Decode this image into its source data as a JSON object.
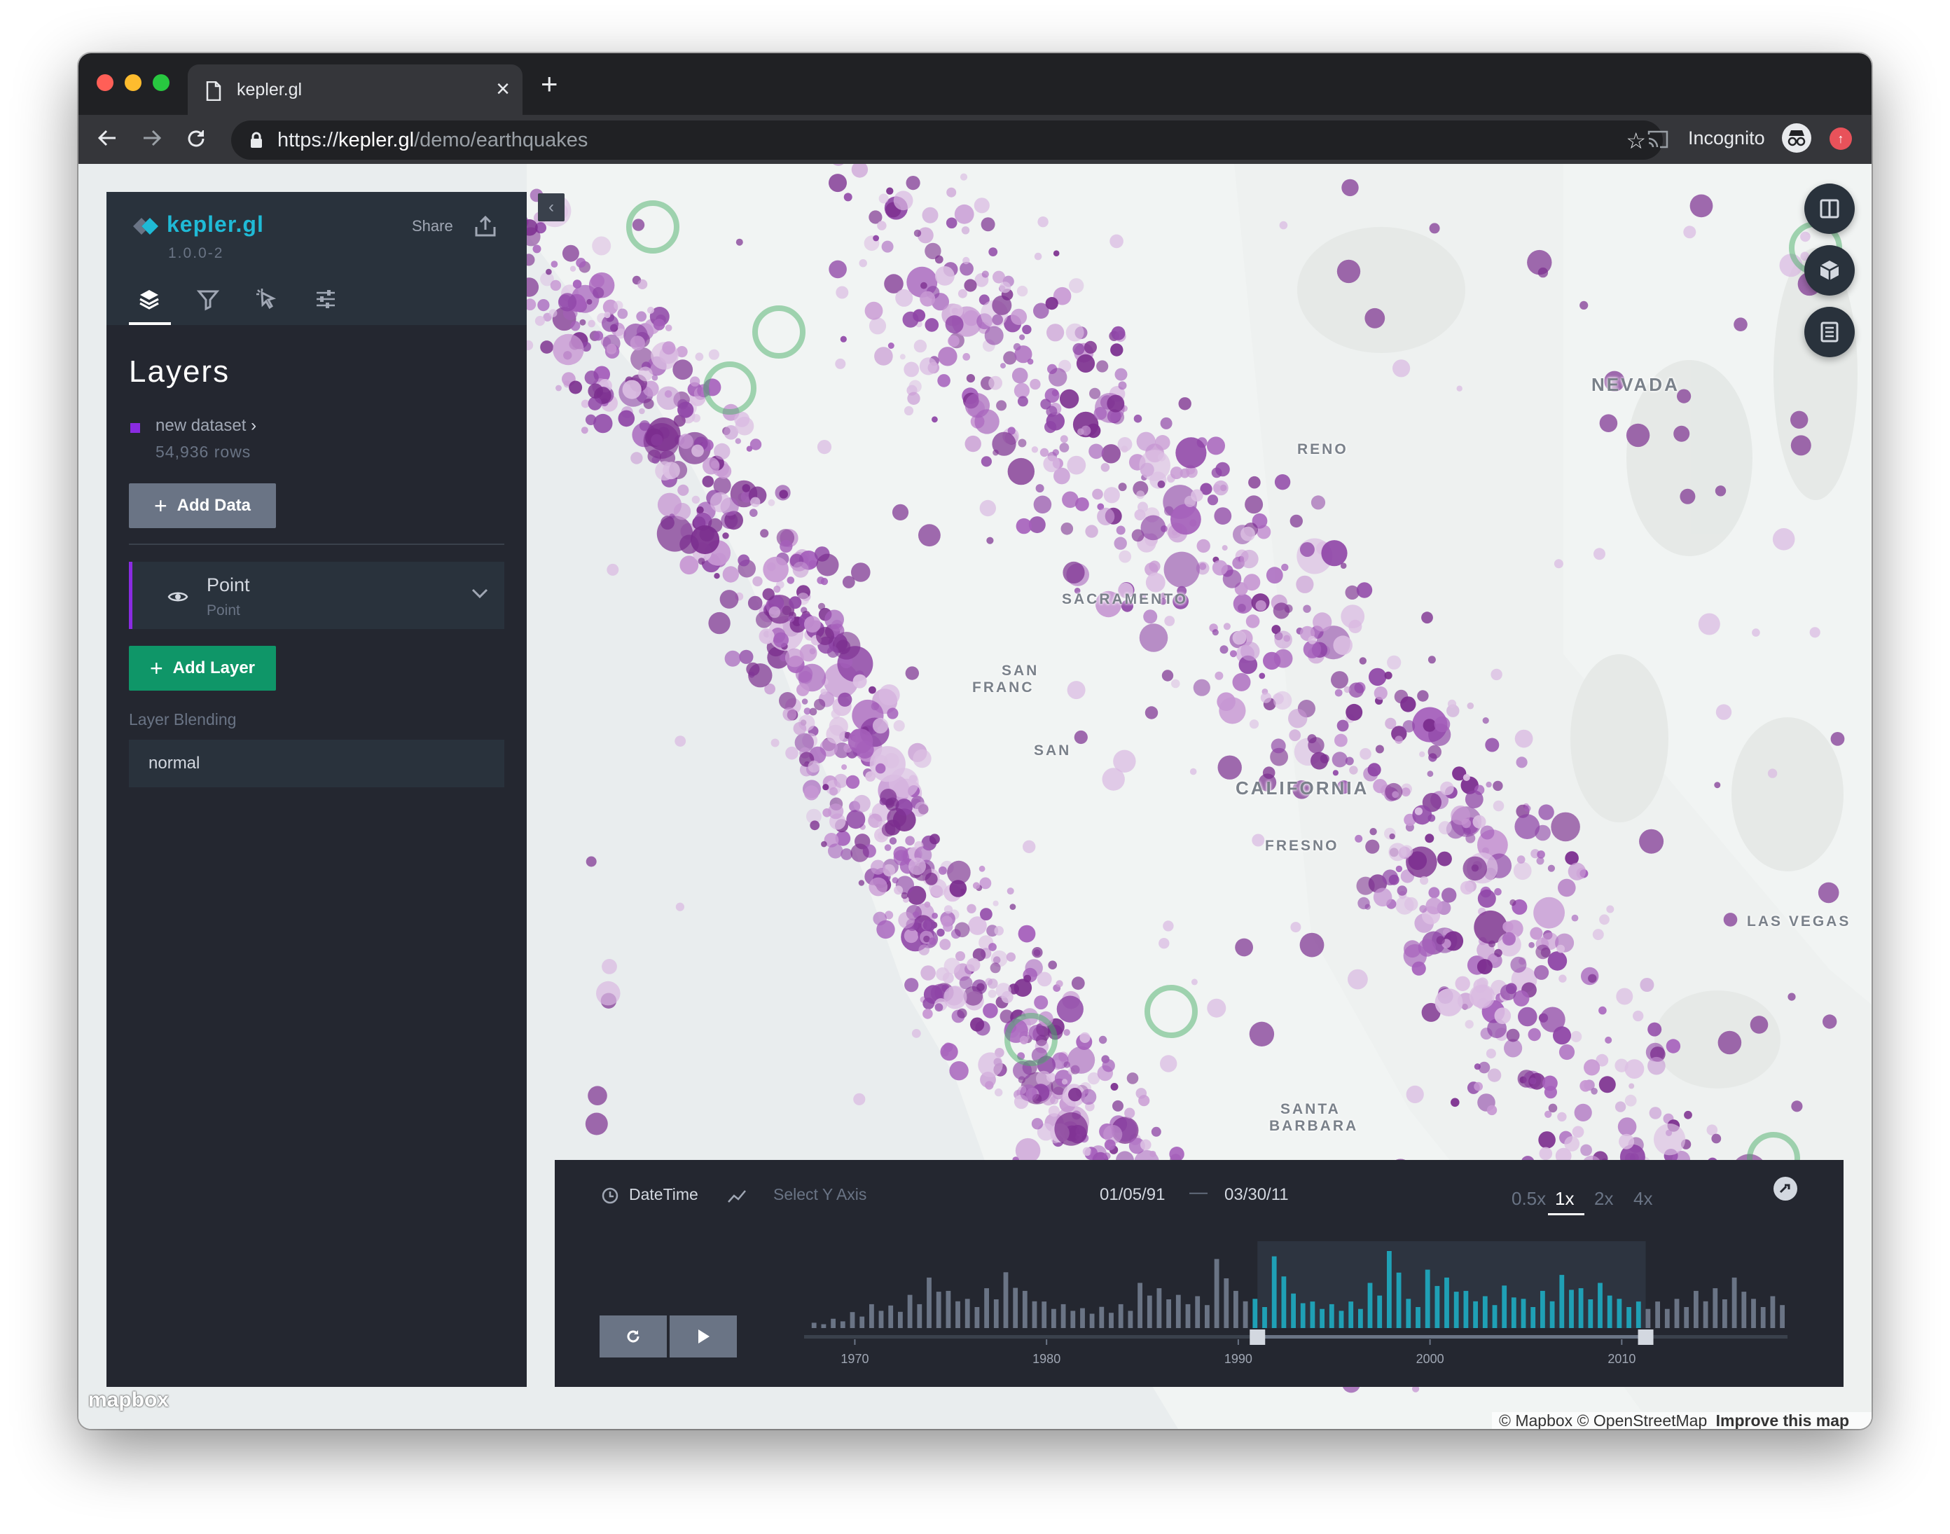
{
  "browser": {
    "tab_title": "kepler.gl",
    "url_scheme": "https://",
    "url_host": "kepler.gl",
    "url_path": "/demo/earthquakes",
    "profile_label": "Incognito",
    "traffic_lights": [
      "#ff5f57",
      "#febc2e",
      "#28c840"
    ]
  },
  "sidebar": {
    "brand": "kepler.gl",
    "version": "1.0.0-2",
    "share_label": "Share",
    "tabs": [
      "layers-icon",
      "filter-icon",
      "interaction-icon",
      "map-settings-icon"
    ],
    "active_tab": "layers",
    "heading": "Layers",
    "dataset": {
      "name": "new dataset",
      "rows": "54,936 rows",
      "color": "#8a2be2"
    },
    "add_data_label": "Add Data",
    "layer": {
      "name": "Point",
      "type": "Point",
      "color": "#8a2be2"
    },
    "add_layer_label": "Add Layer",
    "blending_label": "Layer Blending",
    "blending_value": "normal"
  },
  "map": {
    "labels": [
      "NEVADA",
      "SACRAMENTO",
      "CALIFORNIA",
      "FRESNO",
      "LAS VEGAS",
      "SANTA",
      "BARBARA",
      "SAN",
      "FRANC",
      "SAN",
      "RENO"
    ],
    "controls": [
      "split-map-icon",
      "3d-view-icon",
      "legend-icon"
    ],
    "point_color": "#7b2d8e",
    "attribution": "© Mapbox © OpenStreetMap",
    "improve_label": "Improve this map",
    "logo": "mapbox"
  },
  "time_panel": {
    "field": "DateTime",
    "y_axis_placeholder": "Select Y Axis",
    "start": "01/05/91",
    "end": "03/30/11",
    "speeds": [
      "0.5x",
      "1x",
      "2x",
      "4x"
    ],
    "active_speed": "1x",
    "axis_ticks": [
      "1970",
      "1980",
      "1990",
      "2000",
      "2010"
    ],
    "selection_range": [
      1991.0,
      2011.25
    ],
    "axis_domain": [
      1967.5,
      2018.5
    ],
    "histogram": {
      "bar_years": [
        1968,
        1969,
        1970,
        1971,
        1972,
        1973,
        1974,
        1975,
        1976,
        1977,
        1978,
        1979,
        1980,
        1981,
        1982,
        1983,
        1984,
        1985,
        1986,
        1987,
        1988,
        1989,
        1990,
        1991,
        1992,
        1993,
        1994,
        1995,
        1996,
        1997,
        1998,
        1999,
        2000,
        2001,
        2002,
        2003,
        2004,
        2005,
        2006,
        2007,
        2008,
        2009,
        2010,
        2011,
        2012,
        2013,
        2014,
        2015,
        2016,
        2017,
        2018
      ],
      "counts": [
        4,
        7,
        12,
        18,
        17,
        25,
        38,
        28,
        22,
        30,
        42,
        28,
        20,
        18,
        15,
        16,
        18,
        34,
        30,
        25,
        24,
        52,
        28,
        22,
        54,
        26,
        20,
        18,
        20,
        34,
        58,
        22,
        44,
        38,
        28,
        24,
        32,
        22,
        28,
        40,
        30,
        34,
        22,
        20,
        20,
        22,
        28,
        30,
        38,
        22,
        24
      ]
    },
    "selected_bar_color": "#1fa0b5",
    "unselected_bar_color": "#6a7485"
  }
}
